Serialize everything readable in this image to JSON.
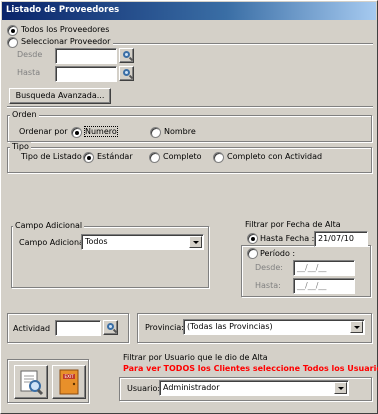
{
  "window": {
    "title": "Listado de Proveedores"
  },
  "proveedores": {
    "todos_label": "Todos los Proveedores",
    "seleccionar_label": "Seleccionar Proveedor",
    "desde_label": "Desde",
    "hasta_label": "Hasta",
    "desde_value": "",
    "hasta_value": ""
  },
  "busqueda_button": "Busqueda Avanzada...",
  "orden": {
    "title": "Orden",
    "ordenar_label": "Ordenar por",
    "numero_label": "Numero",
    "nombre_label": "Nombre"
  },
  "tipo": {
    "title": "Tipo",
    "tipo_label": "Tipo de Listado",
    "estandar_label": "Estándar",
    "completo_label": "Completo",
    "completo_actividad_label": "Completo con Actividad"
  },
  "campo_adicional": {
    "title": "Campo Adicional",
    "label": "Campo Adicional",
    "value": "Todos"
  },
  "fecha_alta": {
    "title": "Filtrar por Fecha de Alta",
    "hasta_fecha_label": "Hasta Fecha :",
    "hasta_fecha_value": "21/07/10",
    "periodo_label": "Período :",
    "desde_label": "Desde:",
    "hasta_label": "Hasta:",
    "desde_value": "__/__/__",
    "hasta_value": "__/__/__"
  },
  "actividad": {
    "label": "Actividad",
    "value": ""
  },
  "provincia": {
    "label": "Provincia:",
    "value": "(Todas las Provincias)"
  },
  "usuario_filter": {
    "title": "Filtrar por Usuario que le dio de Alta",
    "warning": "Para ver TODOS los Clientes seleccione Todos los Usuarios",
    "label": "Usuario:",
    "value": "Administrador"
  },
  "icons": {
    "print": "print-preview-icon",
    "exit": "exit-door-icon",
    "search": "magnifier-icon"
  },
  "colors": {
    "title_start": "#0a246a",
    "title_end": "#a6caf0",
    "warning": "#ff0000",
    "face": "#d4d0c8"
  }
}
